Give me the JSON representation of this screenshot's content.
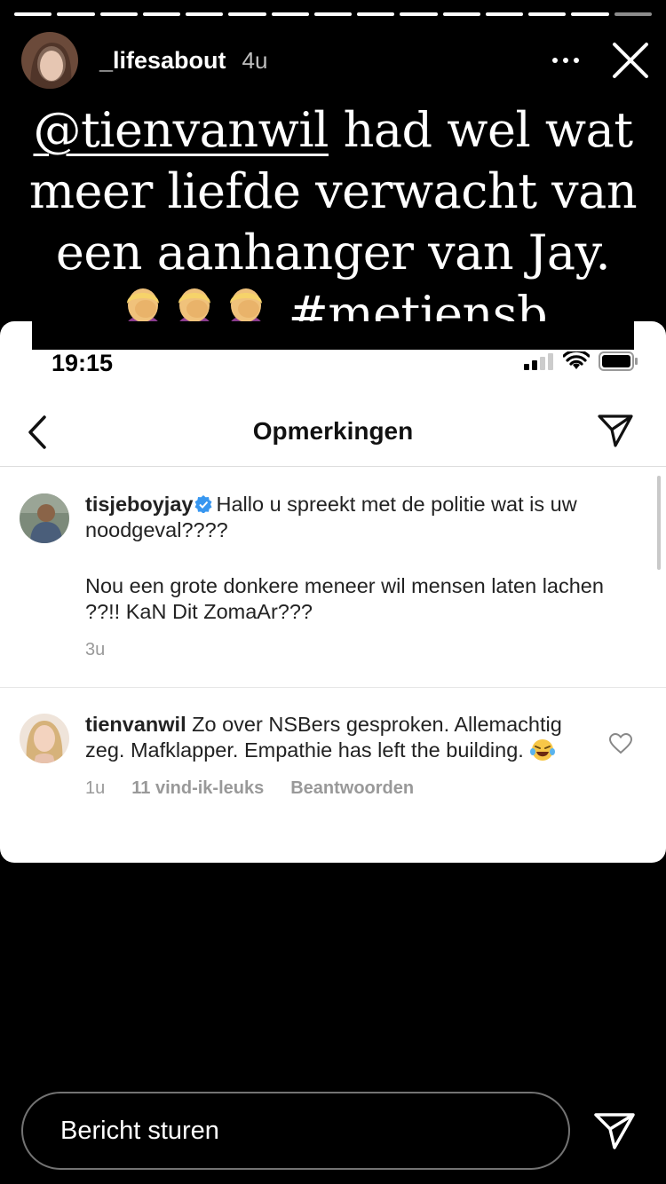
{
  "story": {
    "progress": {
      "segments": 15,
      "completed": 14
    },
    "username": "_lifesabout",
    "time": "4u",
    "icons": {
      "more": "more-icon",
      "close": "close-icon"
    }
  },
  "caption": {
    "mention": "@tienvanwil",
    "text": " had wel wat meer liefde verwacht van een aanhanger van Jay.",
    "emoji": "facepalm-emoji",
    "hashtag": "#metjensb"
  },
  "screenshot": {
    "status_time": "19:15",
    "title": "Opmerkingen",
    "comments": [
      {
        "user": "tisjeboyjay",
        "verified": true,
        "text": "Hallo u spreekt met de politie wat is uw noodgeval????",
        "text2": "Nou een grote donkere meneer wil mensen laten lachen ??!! KaN Dit ZomaAr???",
        "time": "3u"
      },
      {
        "user": "tienvanwil",
        "text": "Zo over NSBers gesproken. Allemachtig zeg. Mafklapper. Empathie has left the building.",
        "emoji": "laughing-emoji",
        "time": "1u",
        "likes": "11 vind-ik-leuks",
        "reply": "Beantwoorden"
      }
    ]
  },
  "message": {
    "placeholder": "Bericht sturen"
  },
  "colors": {
    "background": "#000000",
    "card": "#ffffff",
    "verified": "#3897f0",
    "meta": "#999999"
  }
}
